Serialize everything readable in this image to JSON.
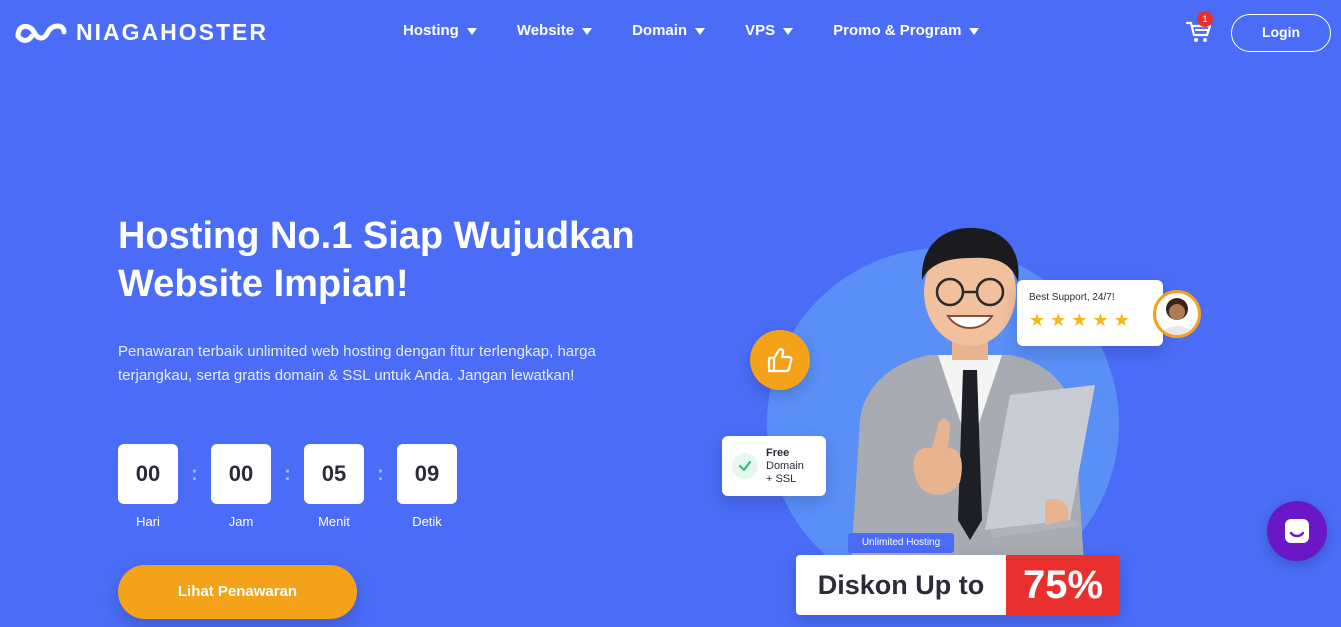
{
  "brand": {
    "name": "NIAGAHOSTER"
  },
  "nav": {
    "items": [
      {
        "label": "Hosting"
      },
      {
        "label": "Website"
      },
      {
        "label": "Domain"
      },
      {
        "label": "VPS"
      },
      {
        "label": "Promo & Program"
      }
    ],
    "cart_count": "1",
    "login_label": "Login"
  },
  "hero": {
    "title": "Hosting No.1 Siap Wujudkan Website Impian!",
    "description": "Penawaran terbaik unlimited web hosting dengan fitur terlengkap, harga terjangkau, serta gratis domain & SSL untuk Anda. Jangan lewatkan!",
    "cta_label": "Lihat Penawaran"
  },
  "countdown": [
    {
      "value": "00",
      "label": "Hari"
    },
    {
      "value": "00",
      "label": "Jam"
    },
    {
      "value": "05",
      "label": "Menit"
    },
    {
      "value": "09",
      "label": "Detik"
    }
  ],
  "illustration": {
    "support_text": "Best Support, 24/7!",
    "rating_stars": 5,
    "ssl_line1": "Free",
    "ssl_line2": "Domain",
    "ssl_line3": "+ SSL",
    "promo_tag": "Unlimited Hosting",
    "promo_text": "Diskon Up to",
    "promo_value": "75%"
  },
  "colors": {
    "background": "#4a6cf7",
    "accent_orange": "#f5a21b",
    "promo_red": "#e8312f",
    "chat_purple": "#6a17c8"
  },
  "icons": {
    "cart": "shopping-cart-icon",
    "chat": "chat-icon",
    "thumb": "thumbs-up-icon",
    "check": "check-icon",
    "star": "star-icon"
  }
}
